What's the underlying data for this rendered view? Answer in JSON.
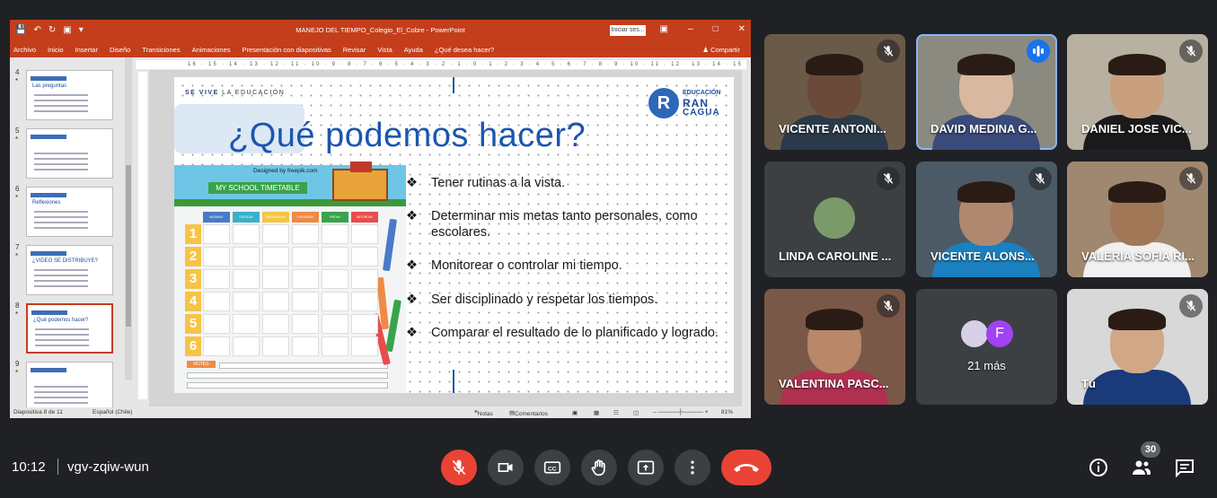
{
  "ppt": {
    "document_title": "MANEJO DEL TIEMPO_Colegio_El_Cobre  -  PowerPoint",
    "signin_label": "Iniciar ses...",
    "ribbon_tabs": [
      "Archivo",
      "Inicio",
      "Insertar",
      "Diseño",
      "Transiciones",
      "Animaciones",
      "Presentación con diapositivas",
      "Revisar",
      "Vista",
      "Ayuda",
      "¿Qué desea hacer?"
    ],
    "share_label": "Compartir",
    "ruler_numbers": "16 · 15 · 14 · 13 · 12 · 11 · 10 · 9 · 8 · 7 · 6 · 5 · 4 · 3 · 2 · 1 · 0 · 1 · 2 · 3 · 4 · 5 · 6 · 7 · 8 · 9 · 10 · 11 · 12 · 13 · 14 · 15 · 16",
    "thumbnails": [
      {
        "number": "4",
        "caption": "Las preguntas"
      },
      {
        "number": "5",
        "caption": ""
      },
      {
        "number": "6",
        "caption": "Reflexiones"
      },
      {
        "number": "7",
        "caption": "¿VIDEO SE DISTRIBUYE?"
      },
      {
        "number": "8",
        "caption": "¿Qué podemos hacer?"
      },
      {
        "number": "9",
        "caption": ""
      }
    ],
    "slide": {
      "tagline_bold": "SE VIVE",
      "tagline_rest": " LA EDUCACIÓN",
      "title": "¿Qué podemos hacer?",
      "logo": {
        "letter": "R",
        "line1": "EDUCACIÓN",
        "line2": "RAN",
        "line3": "CAGUA"
      },
      "timetable": {
        "credit": "Designed by freepik.com",
        "heading": "MY SCHOOL TIMETABLE",
        "days": [
          "MONDAY",
          "TUESDAY",
          "WEDNESDAY",
          "THURSDAY",
          "FRIDAY",
          "SATURDAY"
        ],
        "rows": [
          "1",
          "2",
          "3",
          "4",
          "5",
          "6"
        ],
        "notes_label": "NOTES"
      },
      "bullets": [
        "Tener rutinas a la vista.",
        "Determinar mis metas tanto personales, como escolares.",
        "Monitorear o controlar mi tiempo.",
        "Ser disciplinado y respetar los tiempos.",
        "Comparar el resultado de lo planificado y logrado."
      ],
      "bullet_marker": "❖"
    },
    "status": {
      "slide_counter": "Diapositiva 8 de 11",
      "language": "Español (Chile)",
      "notes_label": "Notas",
      "comments_label": "Comentarios",
      "zoom": "81%"
    }
  },
  "meet": {
    "participants": [
      {
        "name": "VICENTE ANTONI...",
        "muted": true,
        "speaking": false
      },
      {
        "name": "DAVID MEDINA G...",
        "muted": false,
        "speaking": true
      },
      {
        "name": "DANIEL JOSE VIC...",
        "muted": true,
        "speaking": false
      },
      {
        "name": "LINDA CAROLINE ...",
        "muted": true,
        "speaking": false
      },
      {
        "name": "VICENTE ALONS...",
        "muted": true,
        "speaking": false
      },
      {
        "name": "VALERIA SOFIA RI...",
        "muted": true,
        "speaking": false
      },
      {
        "name": "VALENTINA PASC...",
        "muted": true,
        "speaking": false
      },
      {
        "name": "21 más",
        "muted": false,
        "speaking": false,
        "avatar_letter": "F"
      },
      {
        "name": "Tú",
        "muted": true,
        "speaking": false
      }
    ],
    "clock": "10:12",
    "meeting_code": "vgv-zqiw-wun",
    "participant_count": "30",
    "colors": {
      "hangup": "#ea4335",
      "speaking_outline": "#8ab4f8",
      "other_avatar": "#a142f4"
    }
  }
}
